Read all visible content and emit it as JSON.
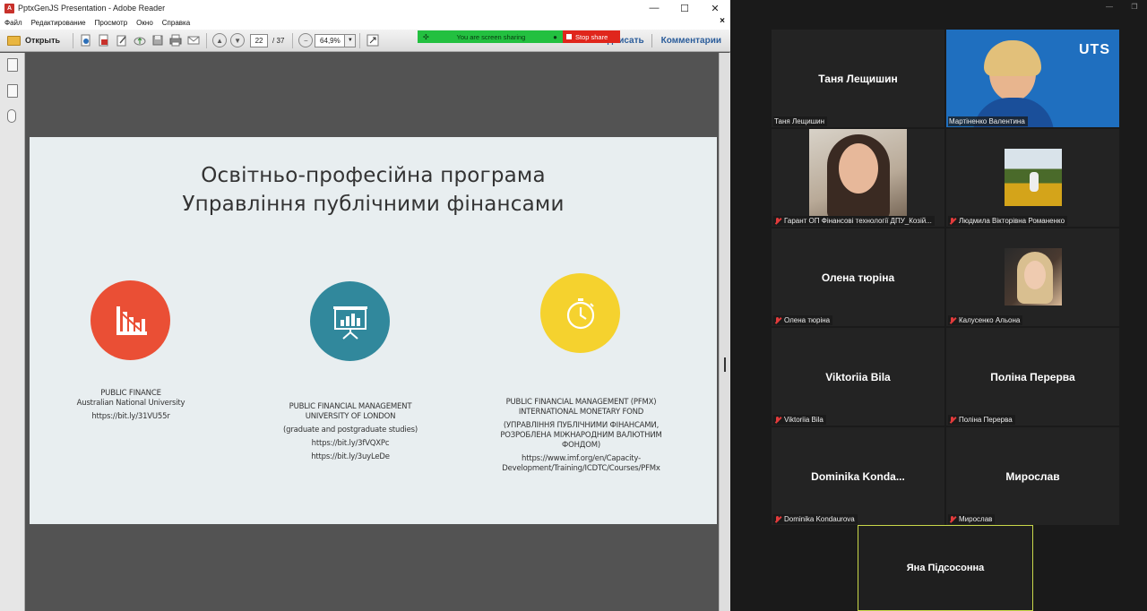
{
  "reader": {
    "window_title": "PptxGenJS Presentation - Adobe Reader",
    "title_icon": "A",
    "controls": {
      "minimize": "—",
      "maximize": "☐",
      "close": "✕"
    },
    "menu": [
      "Файл",
      "Редактирование",
      "Просмотр",
      "Окно",
      "Справка"
    ],
    "menu_close": "×",
    "toolbar": {
      "open_label": "Открыть",
      "page_current": "22",
      "page_total": "/ 37",
      "zoom": "64,9%",
      "sign_label": "одписать",
      "comments_label": "Комментарии"
    },
    "share_banner": {
      "text": "You are screen sharing",
      "stop_label": "Stop share"
    }
  },
  "slide": {
    "title_line1": "Освітньо-професійна програма",
    "title_line2": "Управління публічними фінансами",
    "col1": {
      "heading": "PUBLIC FINANCE",
      "sub": "Australian National University",
      "link": "https://bit.ly/31VU55r"
    },
    "col2": {
      "heading": "PUBLIC FINANCIAL MANAGEMENT",
      "sub": "UNIVERSITY OF LONDON",
      "note": "(graduate and postgraduate studies)",
      "link1": "https://bit.ly/3fVQXPc",
      "link2": "https://bit.ly/3uyLeDe"
    },
    "col3": {
      "heading": "PUBLIC FINANCIAL MANAGEMENT (PFMX)",
      "sub": "INTERNATIONAL MONETARY FOND",
      "note_line1": "(УПРАВЛІННЯ ПУБЛІЧНИМИ ФІНАНСАМИ,",
      "note_line2": "РОЗРОБЛЕНА МІЖНАРОДНИМ ВАЛЮТНИМ",
      "note_line3": "ФОНДОМ)",
      "link_line1": "https://www.imf.org/en/Capacity-",
      "link_line2": "Development/Training/ICDTC/Courses/PFMx"
    },
    "colors": {
      "red": "#ea4f35",
      "blue": "#31889c",
      "yellow": "#f5d22e"
    }
  },
  "gallery": {
    "window_controls": {
      "minimize": "—",
      "restore": "❐"
    },
    "uts_logo": "UTS",
    "participants": [
      {
        "name": "Таня Лещишин",
        "label": "Таня Лещишин",
        "muted": false
      },
      {
        "name": "",
        "label": "Мартіненко Валентина",
        "muted": false
      },
      {
        "name": "",
        "label": "Гарант ОП Фінансові технології ДПУ_Козій...",
        "muted": true
      },
      {
        "name": "",
        "label": "Людмила Вікторівна Романенко",
        "muted": true
      },
      {
        "name": "Олена тюріна",
        "label": "Олена тюріна",
        "muted": true
      },
      {
        "name": "",
        "label": "Калусенко Альона",
        "muted": true
      },
      {
        "name": "Viktoriia Bila",
        "label": "Viktoriia Bila",
        "muted": true
      },
      {
        "name": "Поліна Перерва",
        "label": "Поліна Перерва",
        "muted": true
      },
      {
        "name": "Dominika  Konda...",
        "label": "Dominika Kondaurova",
        "muted": true
      },
      {
        "name": "Мирослав",
        "label": "Мирослав",
        "muted": true
      },
      {
        "name": "Яна Підсосонна",
        "label": "",
        "muted": false
      }
    ]
  }
}
